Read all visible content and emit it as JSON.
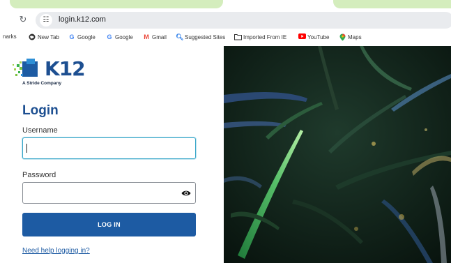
{
  "browser": {
    "url": "login.k12.com",
    "bookmarks": [
      {
        "label": "narks",
        "icon": "bookmark-text-fragment"
      },
      {
        "label": "New Tab",
        "icon": "globe-icon"
      },
      {
        "label": "Google",
        "icon": "google-icon"
      },
      {
        "label": "Google",
        "icon": "google-icon"
      },
      {
        "label": "Gmail",
        "icon": "gmail-icon"
      },
      {
        "label": "Suggested Sites",
        "icon": "search-icon"
      },
      {
        "label": "Imported From IE",
        "icon": "folder-icon"
      },
      {
        "label": "YouTube",
        "icon": "youtube-icon"
      },
      {
        "label": "Maps",
        "icon": "maps-icon"
      }
    ]
  },
  "logo": {
    "name": "K12",
    "tagline": "A Stride Company"
  },
  "form": {
    "title": "Login",
    "username_label": "Username",
    "username_value": "",
    "password_label": "Password",
    "password_value": "",
    "login_button": "LOG IN",
    "help_link": "Need help logging in?"
  },
  "colors": {
    "brand_blue": "#1d4f91",
    "button_blue": "#1d5ba3",
    "focus_ring": "#3aa7c9",
    "tab_highlight": "#d4edbd"
  }
}
